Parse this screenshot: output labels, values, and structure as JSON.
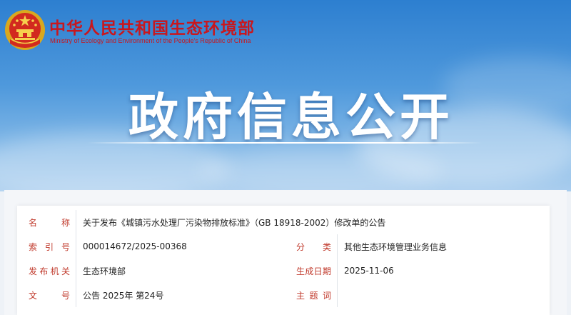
{
  "header": {
    "ministry_name_cn": "中华人民共和国生态环境部",
    "ministry_name_en": "Ministry of Ecology and Environment of the People's Republic of China",
    "banner_title": "政府信息公开"
  },
  "colors": {
    "brand_red": "#c8171e",
    "label_red": "#c0392b",
    "banner_blue": "#2d7fd0"
  },
  "metadata": {
    "name_label": "名　　称",
    "name_value": "关于发布《城镇污水处理厂污染物排放标准》（GB 18918-2002）修改单的公告",
    "index_label": "索 引 号",
    "index_value": "000014672/2025-00368",
    "category_label": "分　　类",
    "category_value": "其他生态环境管理业务信息",
    "issuer_label": "发布机关",
    "issuer_value": "生态环境部",
    "date_label": "生成日期",
    "date_value": "2025-11-06",
    "doc_no_label": "文　　号",
    "doc_no_value": "公告 2025年 第24号",
    "subject_label": "主 题 词",
    "subject_value": ""
  }
}
